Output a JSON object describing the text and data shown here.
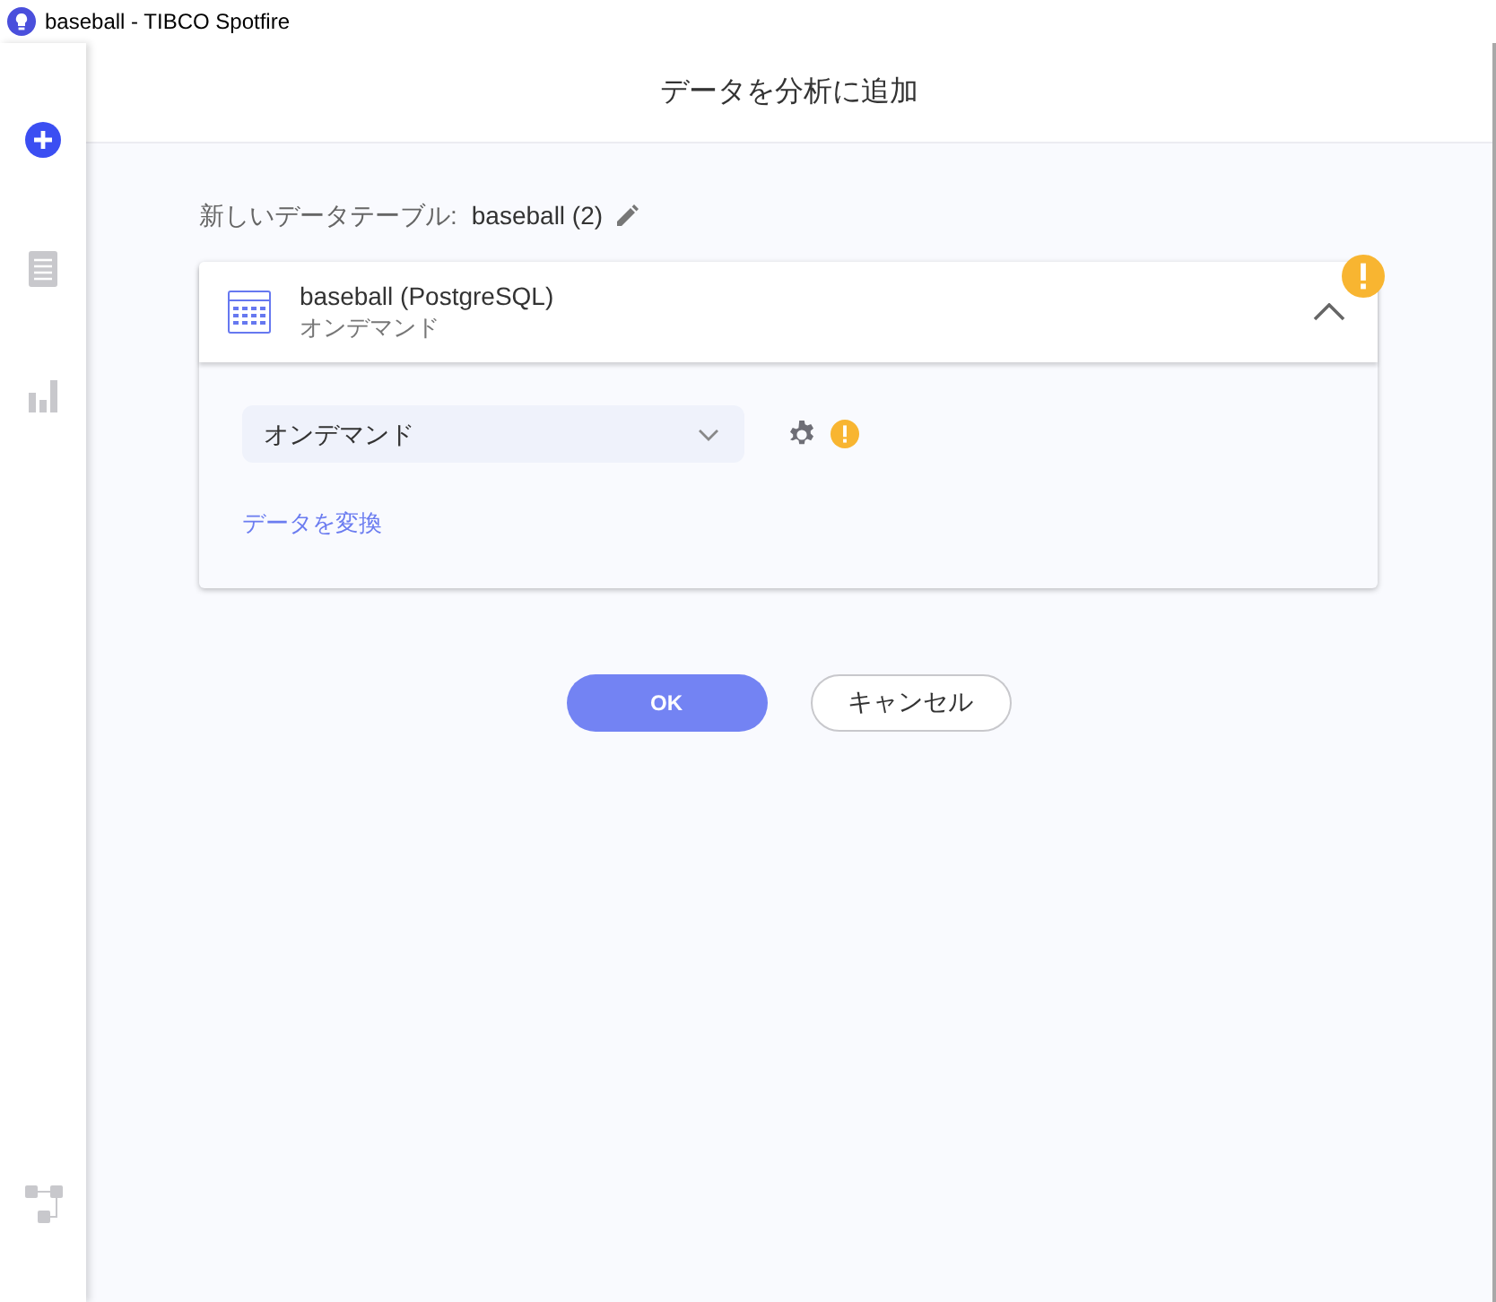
{
  "window": {
    "title": "baseball - TIBCO Spotfire"
  },
  "sidebar": {
    "items": [
      {
        "kind": "add",
        "selected": true
      },
      {
        "kind": "table",
        "selected": false
      },
      {
        "kind": "chart",
        "selected": false
      }
    ],
    "bottom_items": [
      {
        "kind": "flow",
        "selected": false
      }
    ]
  },
  "header": {
    "title": "データを分析に追加"
  },
  "new_table": {
    "label": "新しいデータテーブル:",
    "name": "baseball (2)"
  },
  "source_card": {
    "title": "baseball (PostgreSQL)",
    "subtitle": "オンデマンド",
    "warning": true,
    "expanded": true,
    "mode_select": {
      "value": "オンデマンド"
    },
    "mode_warning": true,
    "transform_link": "データを変換"
  },
  "buttons": [
    {
      "label": "OK",
      "kind": "primary"
    },
    {
      "label": "キャンセル",
      "kind": "secondary"
    }
  ]
}
